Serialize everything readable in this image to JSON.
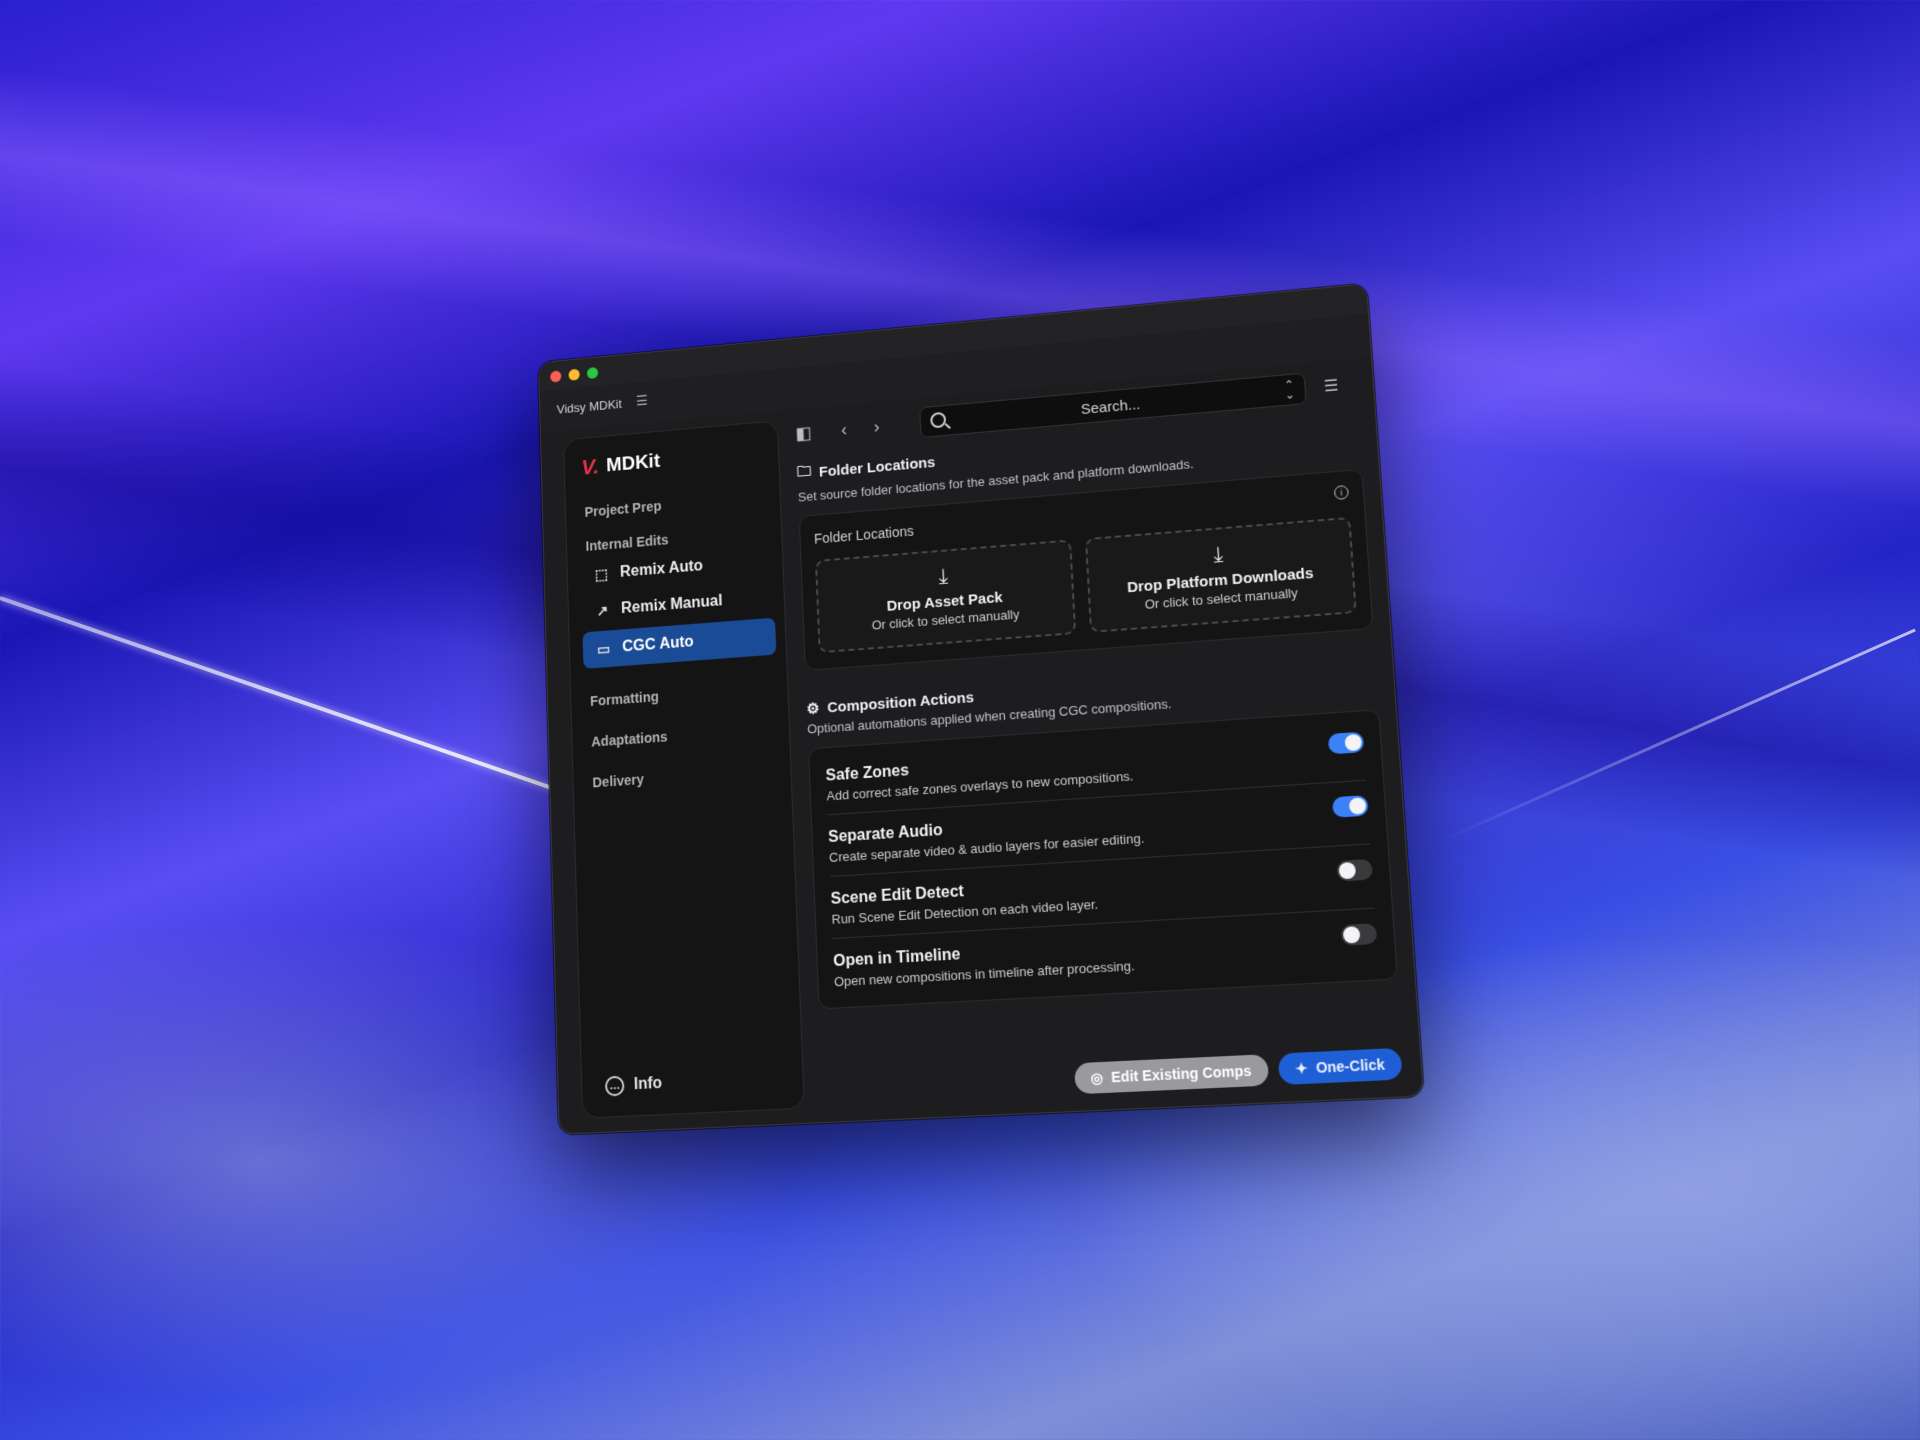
{
  "window": {
    "app_name": "Vidsy MDKit"
  },
  "sidebar": {
    "brand_logo": "V.",
    "brand_name": "MDKit",
    "sections": {
      "project_prep": "Project Prep",
      "internal_edits": "Internal Edits",
      "formatting": "Formatting",
      "adaptations": "Adaptations",
      "delivery": "Delivery"
    },
    "items": [
      {
        "label": "Remix Auto",
        "icon": "selection-cursor-icon"
      },
      {
        "label": "Remix Manual",
        "icon": "pen-curve-icon"
      },
      {
        "label": "CGC Auto",
        "icon": "video-camera-icon",
        "active": true
      }
    ],
    "info_label": "Info"
  },
  "toolbar": {
    "search_placeholder": "Search..."
  },
  "folder_locations": {
    "title": "Folder Locations",
    "subtitle": "Set source folder locations for the asset pack and platform downloads.",
    "card_label": "Folder Locations",
    "drop_asset": {
      "title": "Drop Asset Pack",
      "sub": "Or click to select manually"
    },
    "drop_platform": {
      "title": "Drop Platform Downloads",
      "sub": "Or click to select manually"
    }
  },
  "composition_actions": {
    "title": "Composition Actions",
    "subtitle": "Optional automations applied when creating CGC compositions.",
    "rows": [
      {
        "title": "Safe Zones",
        "desc": "Add correct safe zones overlays to new compositions.",
        "enabled": true
      },
      {
        "title": "Separate Audio",
        "desc": "Create separate video & audio layers for easier editing.",
        "enabled": true
      },
      {
        "title": "Scene Edit Detect",
        "desc": "Run Scene Edit Detection on each video layer.",
        "enabled": false
      },
      {
        "title": "Open in Timeline",
        "desc": "Open new compositions in timeline after processing.",
        "enabled": false
      }
    ]
  },
  "footer": {
    "edit_existing": "Edit Existing Comps",
    "one_click": "One-Click"
  },
  "colors": {
    "accent": "#1a4b97",
    "toggle_on": "#3b82f6",
    "brand": "#e8324a"
  }
}
